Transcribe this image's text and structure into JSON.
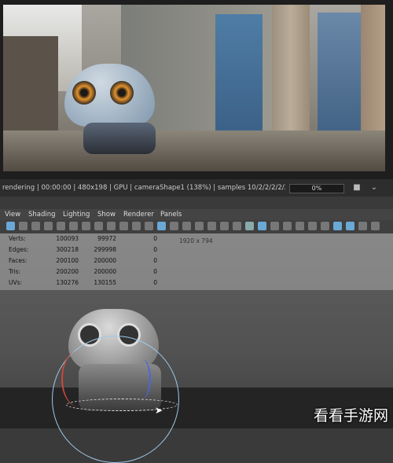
{
  "render_status": {
    "text": "rendering | 00:00:00 | 480x198 | GPU | cameraShape1 (138%) | samples 10/2/2/2/2/2 | 21...",
    "progress_percent": 0,
    "progress_label": "0%",
    "icons": [
      "camera-icon",
      "chevron-down-icon"
    ]
  },
  "menubar": {
    "items": [
      "View",
      "Shading",
      "Lighting",
      "Show",
      "Renderer",
      "Panels"
    ]
  },
  "viewport": {
    "resolution_gate": "1920 x 794",
    "hud": {
      "rows": [
        {
          "label": "Verts:",
          "v1": "100093",
          "v2": "99972",
          "v3": "0"
        },
        {
          "label": "Edges:",
          "v1": "300218",
          "v2": "299998",
          "v3": "0"
        },
        {
          "label": "Faces:",
          "v1": "200100",
          "v2": "200000",
          "v3": "0"
        },
        {
          "label": "Tris:",
          "v1": "200200",
          "v2": "200000",
          "v3": "0"
        },
        {
          "label": "UVs:",
          "v1": "130276",
          "v2": "130155",
          "v3": "0"
        }
      ]
    }
  },
  "watermark": "看看手游网"
}
